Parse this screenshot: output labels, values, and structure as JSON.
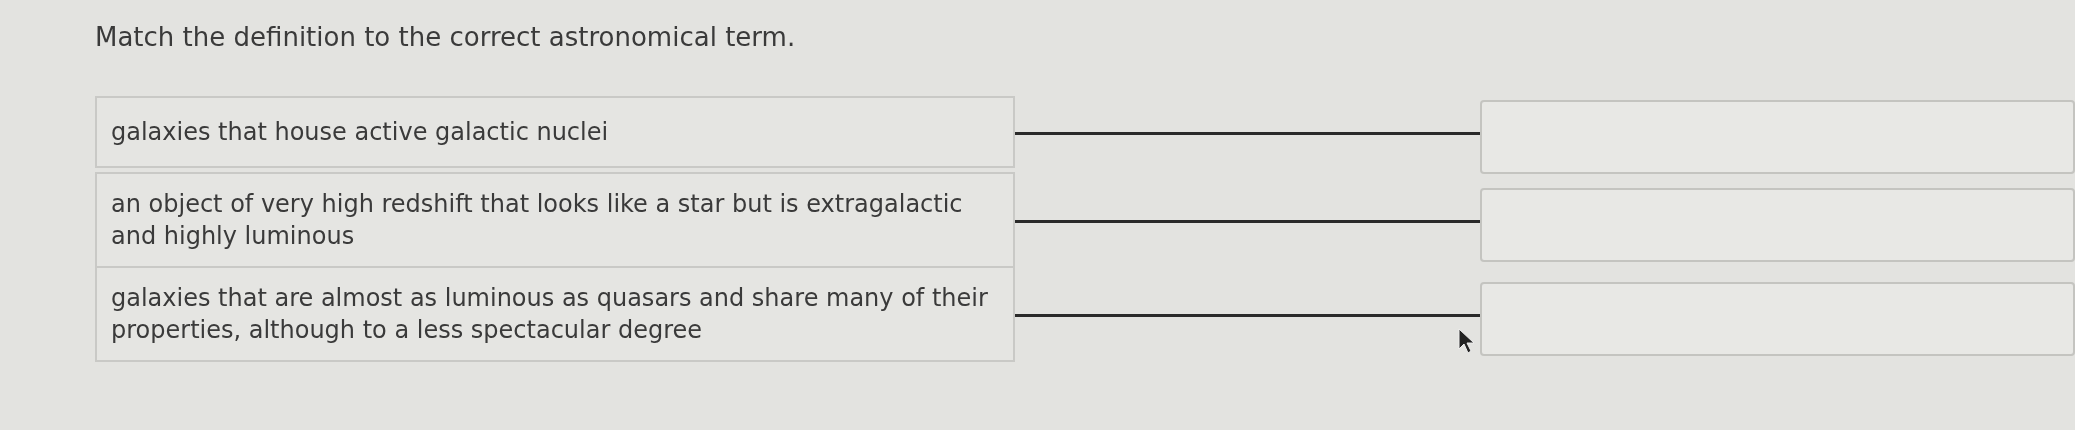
{
  "question": "Match the definition to the correct astronomical term.",
  "pairs": [
    {
      "definition": "galaxies that house active galactic nuclei"
    },
    {
      "definition": "an object of very high redshift that looks like a star but is extragalactic and highly luminous"
    },
    {
      "definition": "galaxies that are almost as luminous as quasars and share many of their properties, although to a less spectacular degree"
    }
  ]
}
